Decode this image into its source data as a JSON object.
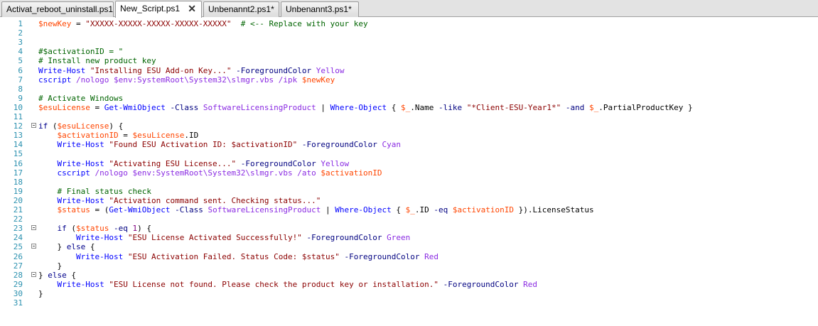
{
  "tabs": [
    {
      "label": "Activat_reboot_uninstall.ps1",
      "active": false
    },
    {
      "label": "New_Script.ps1",
      "active": true,
      "close": "✕"
    },
    {
      "label": "Unbenannt2.ps1*",
      "active": false
    },
    {
      "label": "Unbenannt3.ps1*",
      "active": false
    }
  ],
  "lines": [
    {
      "n": "1",
      "fold": false,
      "tokens": [
        [
          "var",
          "$newKey"
        ],
        [
          "plain",
          " = "
        ],
        [
          "str",
          "\"XXXXX-XXXXX-XXXXX-XXXXX-XXXXX\""
        ],
        [
          "plain",
          "  "
        ],
        [
          "com",
          "# <-- Replace with your key"
        ]
      ]
    },
    {
      "n": "2",
      "fold": false,
      "tokens": []
    },
    {
      "n": "3",
      "fold": false,
      "tokens": []
    },
    {
      "n": "4",
      "fold": false,
      "tokens": [
        [
          "com",
          "#$activationID = \""
        ]
      ]
    },
    {
      "n": "5",
      "fold": false,
      "tokens": [
        [
          "com",
          "# Install new product key"
        ]
      ]
    },
    {
      "n": "6",
      "fold": false,
      "tokens": [
        [
          "cmd",
          "Write-Host"
        ],
        [
          "plain",
          " "
        ],
        [
          "str",
          "\"Installing ESU Add-on Key...\""
        ],
        [
          "plain",
          " "
        ],
        [
          "param",
          "-ForegroundColor"
        ],
        [
          "plain",
          " "
        ],
        [
          "arg",
          "Yellow"
        ]
      ]
    },
    {
      "n": "7",
      "fold": false,
      "tokens": [
        [
          "cmd",
          "cscript"
        ],
        [
          "plain",
          " "
        ],
        [
          "arg",
          "/nologo"
        ],
        [
          "plain",
          " "
        ],
        [
          "arg",
          "$env:SystemRoot\\System32\\slmgr.vbs"
        ],
        [
          "plain",
          " "
        ],
        [
          "arg",
          "/ipk"
        ],
        [
          "plain",
          " "
        ],
        [
          "var",
          "$newKey"
        ]
      ]
    },
    {
      "n": "8",
      "fold": false,
      "tokens": []
    },
    {
      "n": "9",
      "fold": false,
      "tokens": [
        [
          "com",
          "# Activate Windows"
        ]
      ]
    },
    {
      "n": "10",
      "fold": false,
      "tokens": [
        [
          "var",
          "$esuLicense"
        ],
        [
          "plain",
          " = "
        ],
        [
          "cmd",
          "Get-WmiObject"
        ],
        [
          "plain",
          " "
        ],
        [
          "param",
          "-Class"
        ],
        [
          "plain",
          " "
        ],
        [
          "arg",
          "SoftwareLicensingProduct"
        ],
        [
          "plain",
          " | "
        ],
        [
          "cmd",
          "Where-Object"
        ],
        [
          "plain",
          " { "
        ],
        [
          "var",
          "$_"
        ],
        [
          "plain",
          ".Name "
        ],
        [
          "param",
          "-like"
        ],
        [
          "plain",
          " "
        ],
        [
          "str",
          "\"*Client-ESU-Year1*\""
        ],
        [
          "plain",
          " "
        ],
        [
          "param",
          "-and"
        ],
        [
          "plain",
          " "
        ],
        [
          "var",
          "$_"
        ],
        [
          "plain",
          ".PartialProductKey }"
        ]
      ]
    },
    {
      "n": "11",
      "fold": false,
      "tokens": []
    },
    {
      "n": "12",
      "fold": true,
      "tokens": [
        [
          "kw",
          "if"
        ],
        [
          "plain",
          " ("
        ],
        [
          "var",
          "$esuLicense"
        ],
        [
          "plain",
          ") {"
        ]
      ]
    },
    {
      "n": "13",
      "fold": false,
      "tokens": [
        [
          "plain",
          "    "
        ],
        [
          "var",
          "$activationID"
        ],
        [
          "plain",
          " = "
        ],
        [
          "var",
          "$esuLicense"
        ],
        [
          "plain",
          ".ID"
        ]
      ]
    },
    {
      "n": "14",
      "fold": false,
      "tokens": [
        [
          "plain",
          "    "
        ],
        [
          "cmd",
          "Write-Host"
        ],
        [
          "plain",
          " "
        ],
        [
          "str",
          "\"Found ESU Activation ID: $activationID\""
        ],
        [
          "plain",
          " "
        ],
        [
          "param",
          "-ForegroundColor"
        ],
        [
          "plain",
          " "
        ],
        [
          "arg",
          "Cyan"
        ]
      ]
    },
    {
      "n": "15",
      "fold": false,
      "tokens": []
    },
    {
      "n": "16",
      "fold": false,
      "tokens": [
        [
          "plain",
          "    "
        ],
        [
          "cmd",
          "Write-Host"
        ],
        [
          "plain",
          " "
        ],
        [
          "str",
          "\"Activating ESU License...\""
        ],
        [
          "plain",
          " "
        ],
        [
          "param",
          "-ForegroundColor"
        ],
        [
          "plain",
          " "
        ],
        [
          "arg",
          "Yellow"
        ]
      ]
    },
    {
      "n": "17",
      "fold": false,
      "tokens": [
        [
          "plain",
          "    "
        ],
        [
          "cmd",
          "cscript"
        ],
        [
          "plain",
          " "
        ],
        [
          "arg",
          "/nologo"
        ],
        [
          "plain",
          " "
        ],
        [
          "arg",
          "$env:SystemRoot\\System32\\slmgr.vbs"
        ],
        [
          "plain",
          " "
        ],
        [
          "arg",
          "/ato"
        ],
        [
          "plain",
          " "
        ],
        [
          "var",
          "$activationID"
        ]
      ]
    },
    {
      "n": "18",
      "fold": false,
      "tokens": []
    },
    {
      "n": "19",
      "fold": false,
      "tokens": [
        [
          "plain",
          "    "
        ],
        [
          "com",
          "# Final status check"
        ]
      ]
    },
    {
      "n": "20",
      "fold": false,
      "tokens": [
        [
          "plain",
          "    "
        ],
        [
          "cmd",
          "Write-Host"
        ],
        [
          "plain",
          " "
        ],
        [
          "str",
          "\"Activation command sent. Checking status...\""
        ]
      ]
    },
    {
      "n": "21",
      "fold": false,
      "tokens": [
        [
          "plain",
          "    "
        ],
        [
          "var",
          "$status"
        ],
        [
          "plain",
          " = ("
        ],
        [
          "cmd",
          "Get-WmiObject"
        ],
        [
          "plain",
          " "
        ],
        [
          "param",
          "-Class"
        ],
        [
          "plain",
          " "
        ],
        [
          "arg",
          "SoftwareLicensingProduct"
        ],
        [
          "plain",
          " | "
        ],
        [
          "cmd",
          "Where-Object"
        ],
        [
          "plain",
          " { "
        ],
        [
          "var",
          "$_"
        ],
        [
          "plain",
          ".ID "
        ],
        [
          "param",
          "-eq"
        ],
        [
          "plain",
          " "
        ],
        [
          "var",
          "$activationID"
        ],
        [
          "plain",
          " }).LicenseStatus"
        ]
      ]
    },
    {
      "n": "22",
      "fold": false,
      "tokens": []
    },
    {
      "n": "23",
      "fold": true,
      "tokens": [
        [
          "plain",
          "    "
        ],
        [
          "kw",
          "if"
        ],
        [
          "plain",
          " ("
        ],
        [
          "var",
          "$status"
        ],
        [
          "plain",
          " "
        ],
        [
          "param",
          "-eq"
        ],
        [
          "plain",
          " "
        ],
        [
          "num",
          "1"
        ],
        [
          "plain",
          ") {"
        ]
      ]
    },
    {
      "n": "24",
      "fold": false,
      "tokens": [
        [
          "plain",
          "        "
        ],
        [
          "cmd",
          "Write-Host"
        ],
        [
          "plain",
          " "
        ],
        [
          "str",
          "\"ESU License Activated Successfully!\""
        ],
        [
          "plain",
          " "
        ],
        [
          "param",
          "-ForegroundColor"
        ],
        [
          "plain",
          " "
        ],
        [
          "arg",
          "Green"
        ]
      ]
    },
    {
      "n": "25",
      "fold": true,
      "tokens": [
        [
          "plain",
          "    } "
        ],
        [
          "kw",
          "else"
        ],
        [
          "plain",
          " {"
        ]
      ]
    },
    {
      "n": "26",
      "fold": false,
      "tokens": [
        [
          "plain",
          "        "
        ],
        [
          "cmd",
          "Write-Host"
        ],
        [
          "plain",
          " "
        ],
        [
          "str",
          "\"ESU Activation Failed. Status Code: $status\""
        ],
        [
          "plain",
          " "
        ],
        [
          "param",
          "-ForegroundColor"
        ],
        [
          "plain",
          " "
        ],
        [
          "arg",
          "Red"
        ]
      ]
    },
    {
      "n": "27",
      "fold": false,
      "tokens": [
        [
          "plain",
          "    }"
        ]
      ]
    },
    {
      "n": "28",
      "fold": true,
      "tokens": [
        [
          "plain",
          "} "
        ],
        [
          "kw",
          "else"
        ],
        [
          "plain",
          " {"
        ]
      ]
    },
    {
      "n": "29",
      "fold": false,
      "tokens": [
        [
          "plain",
          "    "
        ],
        [
          "cmd",
          "Write-Host"
        ],
        [
          "plain",
          " "
        ],
        [
          "str",
          "\"ESU License not found. Please check the product key or installation.\""
        ],
        [
          "plain",
          " "
        ],
        [
          "param",
          "-ForegroundColor"
        ],
        [
          "plain",
          " "
        ],
        [
          "arg",
          "Red"
        ]
      ]
    },
    {
      "n": "30",
      "fold": false,
      "tokens": [
        [
          "plain",
          "}"
        ]
      ]
    },
    {
      "n": "31",
      "fold": false,
      "tokens": []
    }
  ]
}
